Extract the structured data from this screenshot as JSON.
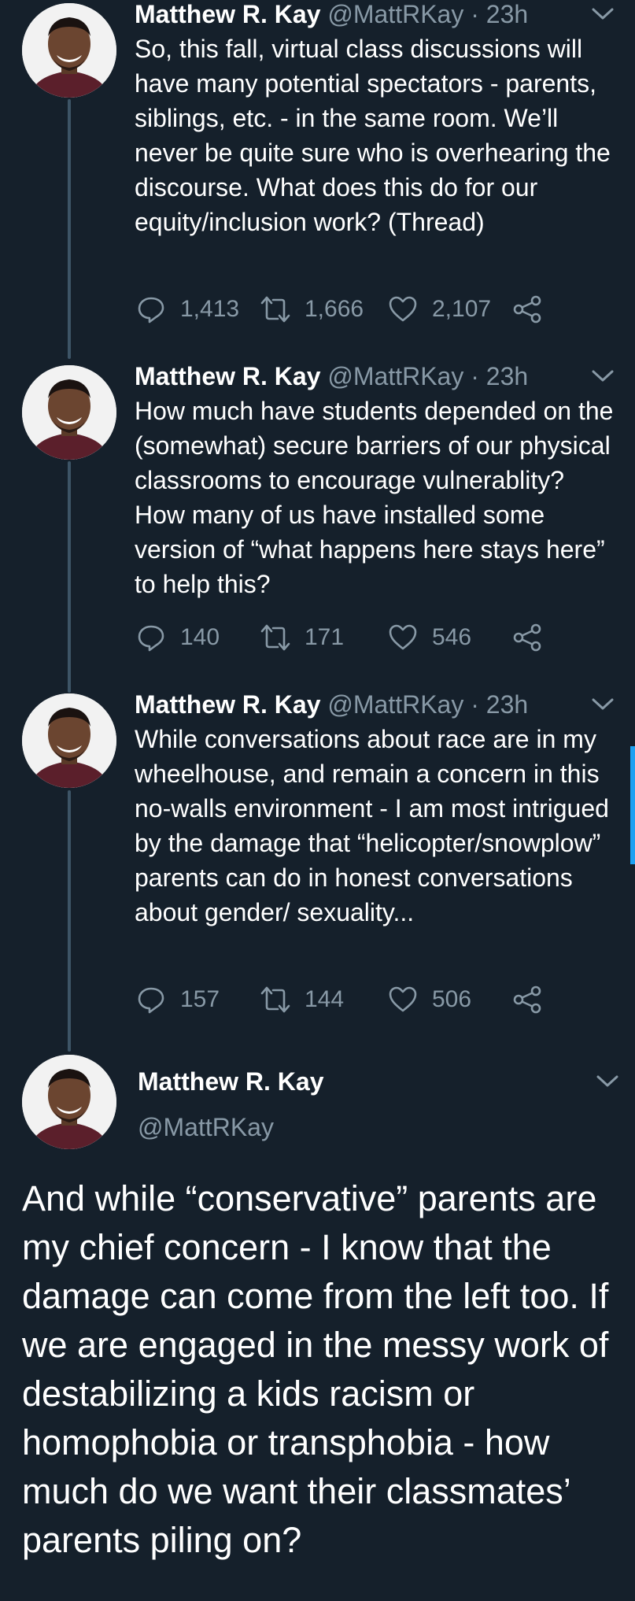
{
  "colors": {
    "background": "#15202b",
    "text_primary": "#ffffff",
    "text_secondary": "#8899a6",
    "thread_line": "#3d5466",
    "accent": "#1da1f2"
  },
  "thread": [
    {
      "name": "Matthew R. Kay",
      "meta": "@MattRKay · 23h",
      "text": "So, this fall, virtual class discussions will have many potential spectators - parents, siblings, etc. - in the same room. We’ll never be quite sure who is overhearing the discourse. What does this do for our equity/inclusion work? (Thread)",
      "replies": "1,413",
      "retweets": "1,666",
      "likes": "2,107"
    },
    {
      "name": "Matthew R. Kay",
      "meta": "@MattRKay · 23h",
      "text": "How much have students depended on the (somewhat) secure barriers of our physical classrooms to encourage vulnerablity? How many of us have installed some version of “what happens here stays here” to help this?",
      "replies": "140",
      "retweets": "171",
      "likes": "546"
    },
    {
      "name": "Matthew R. Kay",
      "meta": "@MattRKay · 23h",
      "text": "While conversations about race are in my wheelhouse, and remain a concern in this no-walls environment - I am most intrigued by the damage that “helicopter/snowplow” parents can do in honest conversations about gender/ sexuality...",
      "replies": "157",
      "retweets": "144",
      "likes": "506"
    }
  ],
  "focused_tweet": {
    "name": "Matthew R. Kay",
    "handle": "@MattRKay",
    "text": "And while “conservative” parents are my chief concern - I know that the damage can come from the left too. If we are engaged in the messy work of destabilizing a kids racism or homophobia or transphobia - how much do we want their classmates’ parents piling on?"
  },
  "icons": {
    "reply": "reply-icon",
    "retweet": "retweet-icon",
    "like": "heart-icon",
    "share": "share-icon",
    "menu": "chevron-down-icon",
    "avatar": "avatar"
  }
}
